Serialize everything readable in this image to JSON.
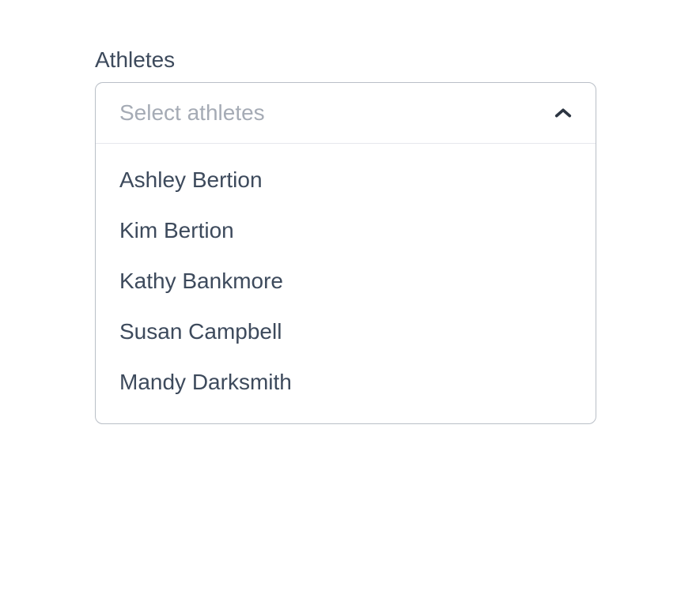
{
  "field": {
    "label": "Athletes",
    "placeholder": "Select athletes",
    "options": [
      "Ashley Bertion",
      "Kim Bertion",
      "Kathy Bankmore",
      "Susan Campbell",
      "Mandy Darksmith"
    ]
  }
}
